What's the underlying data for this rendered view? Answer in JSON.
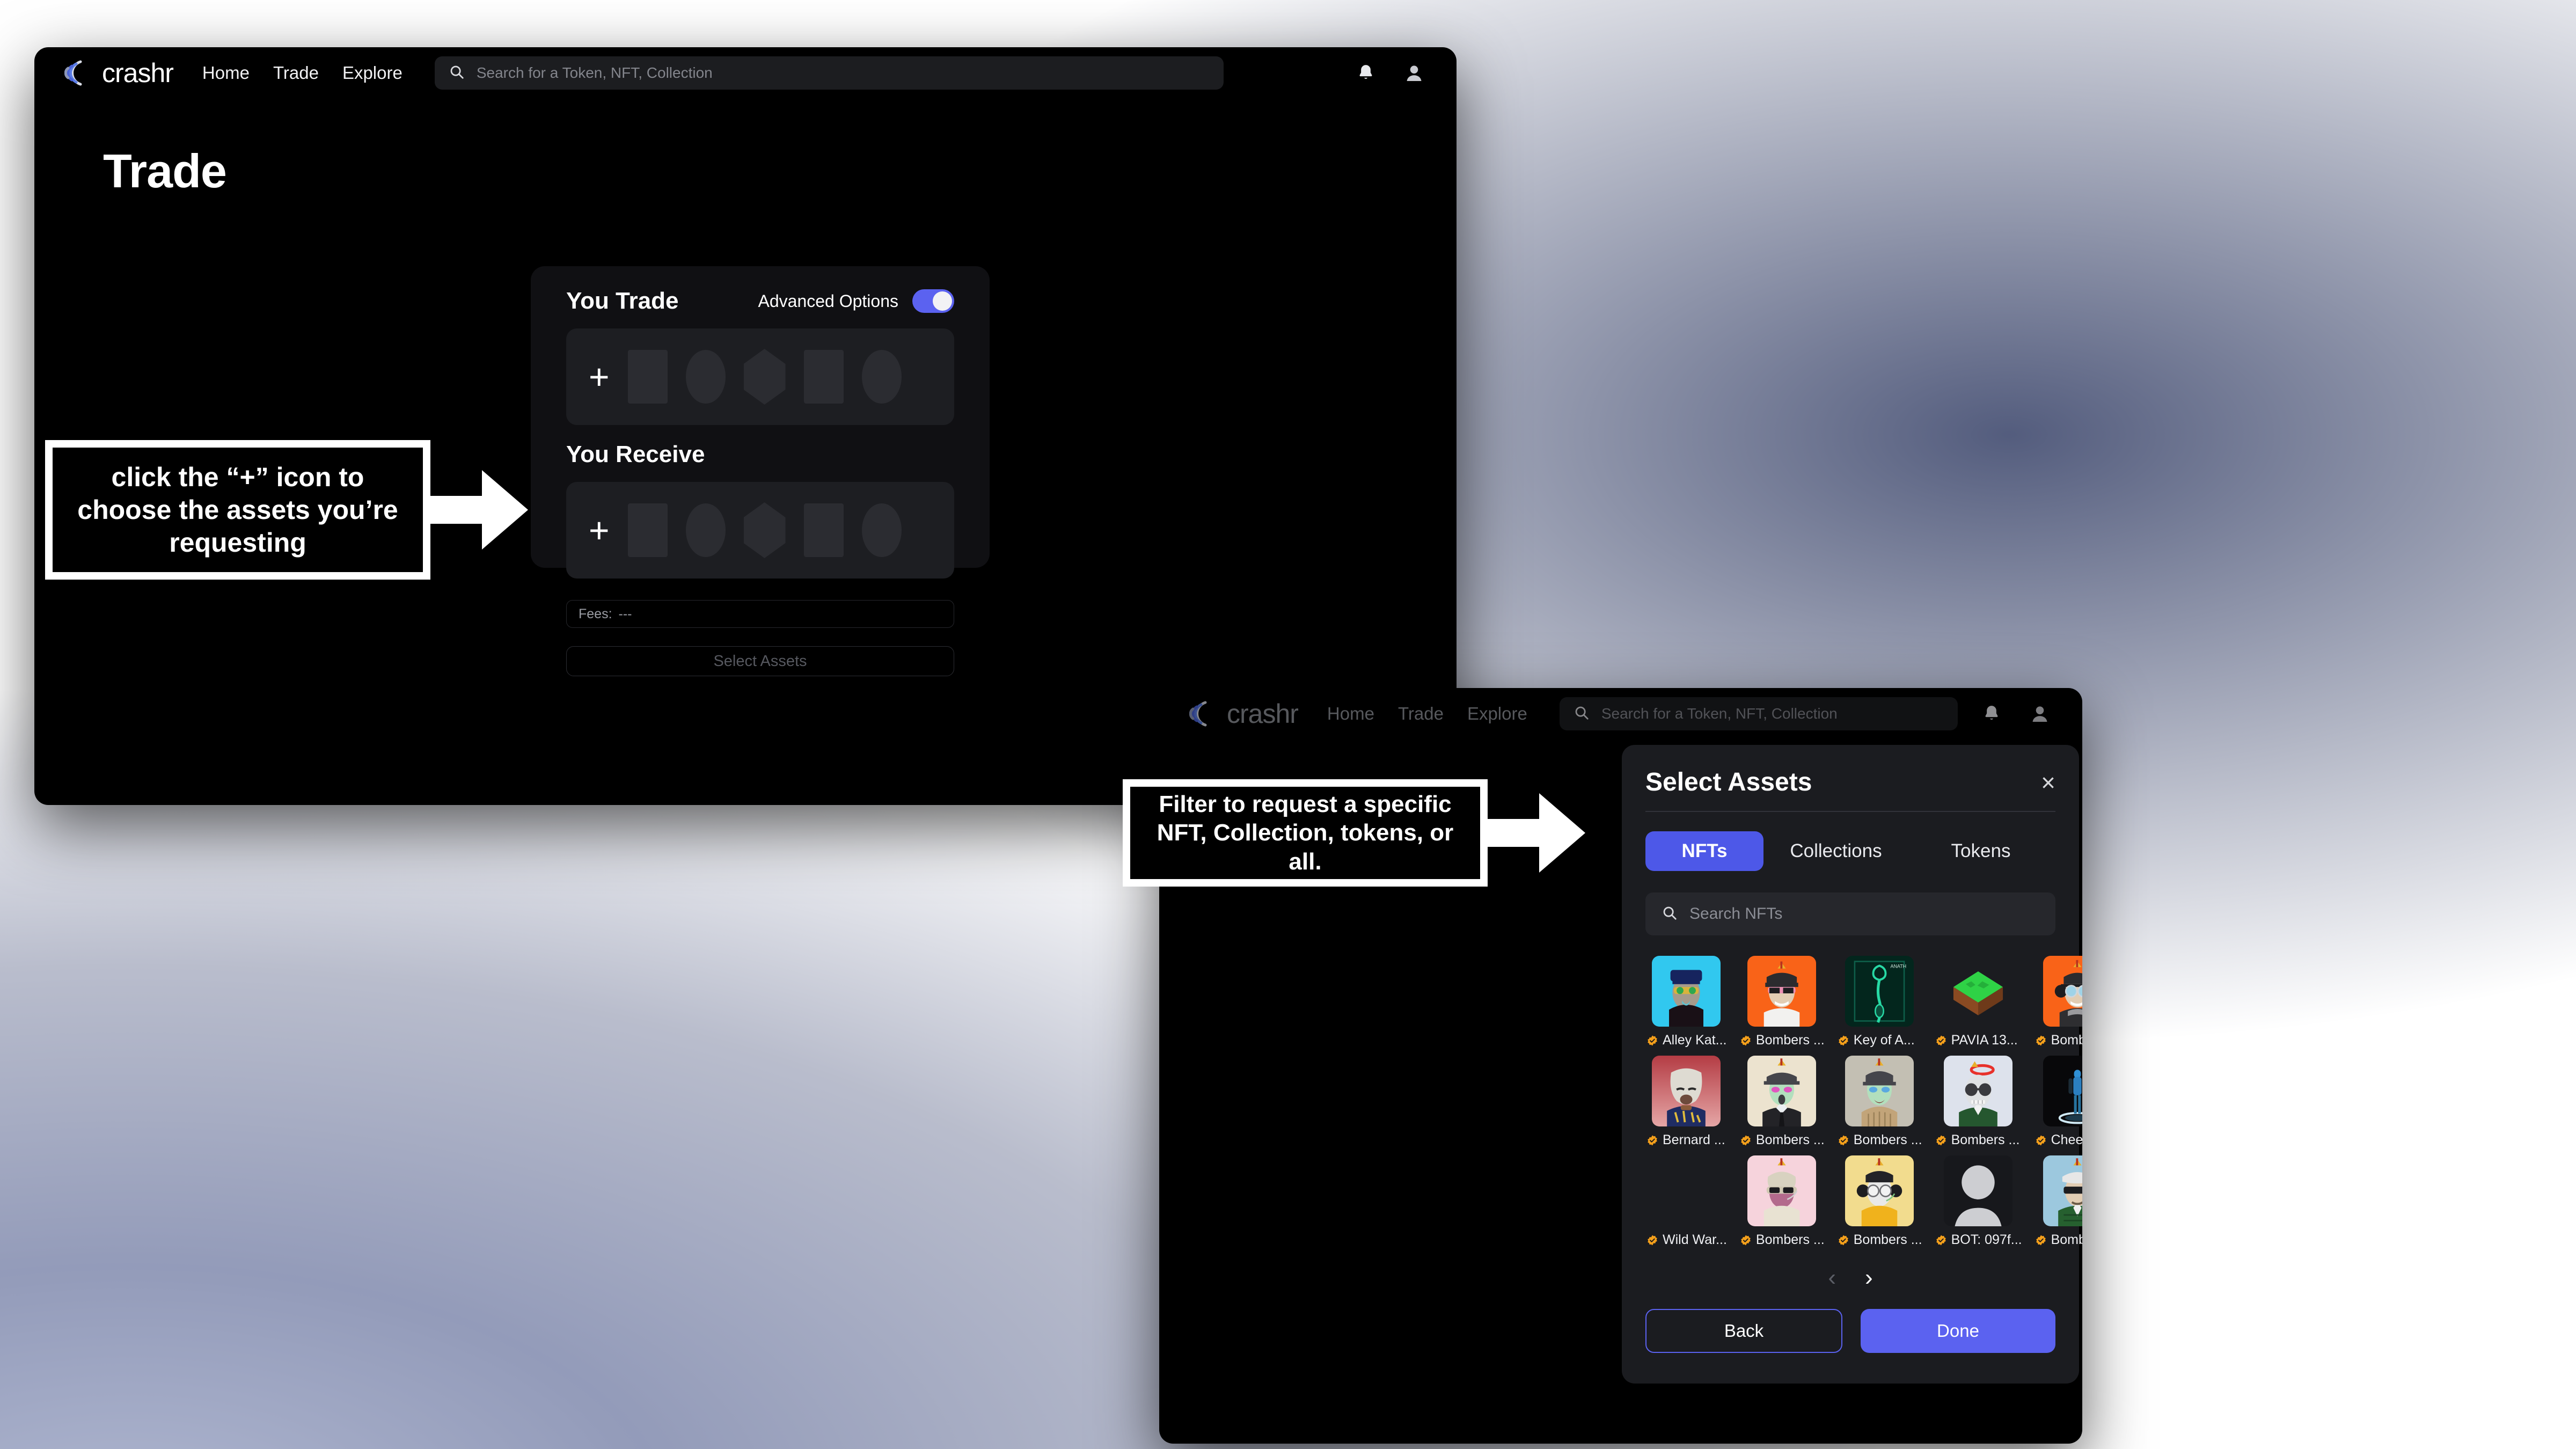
{
  "app": {
    "brand": "crashr",
    "nav": [
      "Home",
      "Trade",
      "Explore"
    ],
    "search_placeholder": "Search for a Token, NFT, Collection",
    "icons": {
      "search": "search-icon",
      "bell": "bell-icon",
      "avatar": "user-avatar-icon"
    },
    "accent": "#5b62f0"
  },
  "main_window": {
    "page_title": "Trade",
    "trade_card": {
      "you_trade_label": "You Trade",
      "advanced_options_label": "Advanced Options",
      "advanced_options_on": true,
      "you_receive_label": "You Receive",
      "add_icon": "+",
      "placeholder_shapes": [
        "square",
        "circle",
        "hexagon",
        "square",
        "circle"
      ],
      "fees_label": "Fees:",
      "fees_value": "---",
      "select_assets_button": "Select Assets"
    }
  },
  "modal_window": {
    "modal": {
      "title": "Select Assets",
      "close_icon": "×",
      "tabs": [
        {
          "label": "NFTs",
          "active": true
        },
        {
          "label": "Collections",
          "active": false
        },
        {
          "label": "Tokens",
          "active": false
        }
      ],
      "search_placeholder": "Search NFTs",
      "nfts": [
        {
          "name": "Alley Kat...",
          "verified": true,
          "bg": "#31c8ef",
          "art": "katana"
        },
        {
          "name": "Bombers ...",
          "verified": true,
          "bg": "#f96318",
          "art": "bomber-pink"
        },
        {
          "name": "Key of A...",
          "verified": true,
          "bg": "#05231c",
          "art": "key"
        },
        {
          "name": "PAVIA 13...",
          "verified": true,
          "bg": "#1b1c20",
          "art": "pavia"
        },
        {
          "name": "Bombers ...",
          "verified": true,
          "bg": "#f96318",
          "art": "bomber-blue"
        },
        {
          "name": "Bernard ...",
          "verified": true,
          "bg": "#c0414a",
          "art": "bernard"
        },
        {
          "name": "Bombers ...",
          "verified": true,
          "bg": "#ece3cf",
          "art": "bomber-suit"
        },
        {
          "name": "Bombers ...",
          "verified": true,
          "bg": "#c3bfb3",
          "art": "bomber-turtleneck"
        },
        {
          "name": "Bombers ...",
          "verified": true,
          "bg": "#dde2ec",
          "art": "bomber-halo"
        },
        {
          "name": "Cheeky R...",
          "verified": true,
          "bg": "#0a0a0c",
          "art": "robot"
        },
        {
          "name": "Wild War...",
          "verified": true,
          "bg": "transparent",
          "art": "none"
        },
        {
          "name": "Bombers ...",
          "verified": true,
          "bg": "#f6d3dc",
          "art": "bomber-bandage"
        },
        {
          "name": "Bombers ...",
          "verified": true,
          "bg": "#f2dc8e",
          "art": "bomber-yellow"
        },
        {
          "name": "BOT: 097f...",
          "verified": true,
          "bg": "#17181c",
          "art": "placeholder-avatar"
        },
        {
          "name": "Bombers ...",
          "verified": true,
          "bg": "#9cc8de",
          "art": "bomber-green"
        }
      ],
      "pagination": {
        "prev": "‹",
        "next": "›",
        "prev_enabled": false,
        "next_enabled": true
      },
      "back_button": "Back",
      "done_button": "Done"
    }
  },
  "annotations": [
    {
      "id": "callout-1",
      "text": "click the “+” icon to choose the assets you’re requesting"
    },
    {
      "id": "callout-2",
      "text": "Filter to request a specific NFT,  Collection, tokens, or all."
    }
  ]
}
